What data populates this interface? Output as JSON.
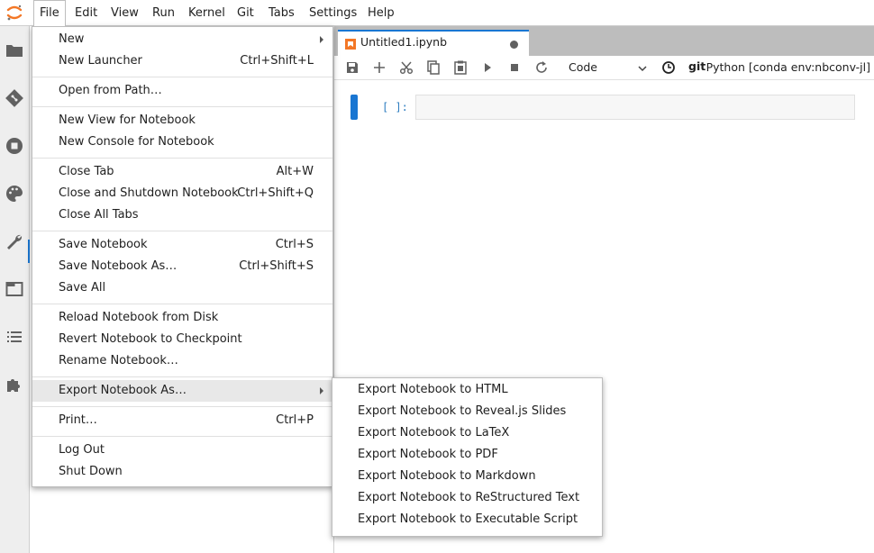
{
  "menubar": {
    "items": [
      {
        "label": "File"
      },
      {
        "label": "Edit"
      },
      {
        "label": "View"
      },
      {
        "label": "Run"
      },
      {
        "label": "Kernel"
      },
      {
        "label": "Git"
      },
      {
        "label": "Tabs"
      },
      {
        "label": "Settings"
      },
      {
        "label": "Help"
      }
    ]
  },
  "file_menu": {
    "items": [
      {
        "label": "New",
        "shortcut": ""
      },
      {
        "label": "New Launcher",
        "shortcut": "Ctrl+Shift+L"
      },
      {
        "label": "Open from Path…",
        "shortcut": ""
      },
      {
        "label": "New View for Notebook",
        "shortcut": ""
      },
      {
        "label": "New Console for Notebook",
        "shortcut": ""
      },
      {
        "label": "Close Tab",
        "shortcut": "Alt+W"
      },
      {
        "label": "Close and Shutdown Notebook",
        "shortcut": "Ctrl+Shift+Q"
      },
      {
        "label": "Close All Tabs",
        "shortcut": ""
      },
      {
        "label": "Save Notebook",
        "shortcut": "Ctrl+S"
      },
      {
        "label": "Save Notebook As…",
        "shortcut": "Ctrl+Shift+S"
      },
      {
        "label": "Save All",
        "shortcut": ""
      },
      {
        "label": "Reload Notebook from Disk",
        "shortcut": ""
      },
      {
        "label": "Revert Notebook to Checkpoint",
        "shortcut": ""
      },
      {
        "label": "Rename Notebook…",
        "shortcut": ""
      },
      {
        "label": "Export Notebook As…",
        "shortcut": ""
      },
      {
        "label": "Print…",
        "shortcut": "Ctrl+P"
      },
      {
        "label": "Log Out",
        "shortcut": ""
      },
      {
        "label": "Shut Down",
        "shortcut": ""
      }
    ]
  },
  "export_submenu": {
    "items": [
      {
        "label": "Export Notebook to HTML"
      },
      {
        "label": "Export Notebook to Reveal.js Slides"
      },
      {
        "label": "Export Notebook to LaTeX"
      },
      {
        "label": "Export Notebook to PDF"
      },
      {
        "label": "Export Notebook to Markdown"
      },
      {
        "label": "Export Notebook to ReStructured Text"
      },
      {
        "label": "Export Notebook to Executable Script"
      }
    ]
  },
  "notebook": {
    "tab_title": "Untitled1.ipynb",
    "cell_type": "Code",
    "git_label": "git",
    "kernel": "Python [conda env:nbconv-jl]",
    "cell_prompt": "[ ]:"
  },
  "icons": {
    "left_sidebar": [
      "folder-icon",
      "git-icon",
      "stop-circle-icon",
      "palette-icon",
      "wrench-icon",
      "tab-icon",
      "list-icon",
      "puzzle-icon"
    ],
    "toolbar": [
      "save-icon",
      "add-icon",
      "cut-icon",
      "copy-icon",
      "paste-icon",
      "run-icon",
      "stop-icon",
      "restart-icon",
      "chevron-down-icon",
      "clock-icon"
    ]
  },
  "colors": {
    "accent": "#1976d2",
    "logo_orange": "#f37726",
    "prompt_blue": "#307fc1"
  }
}
